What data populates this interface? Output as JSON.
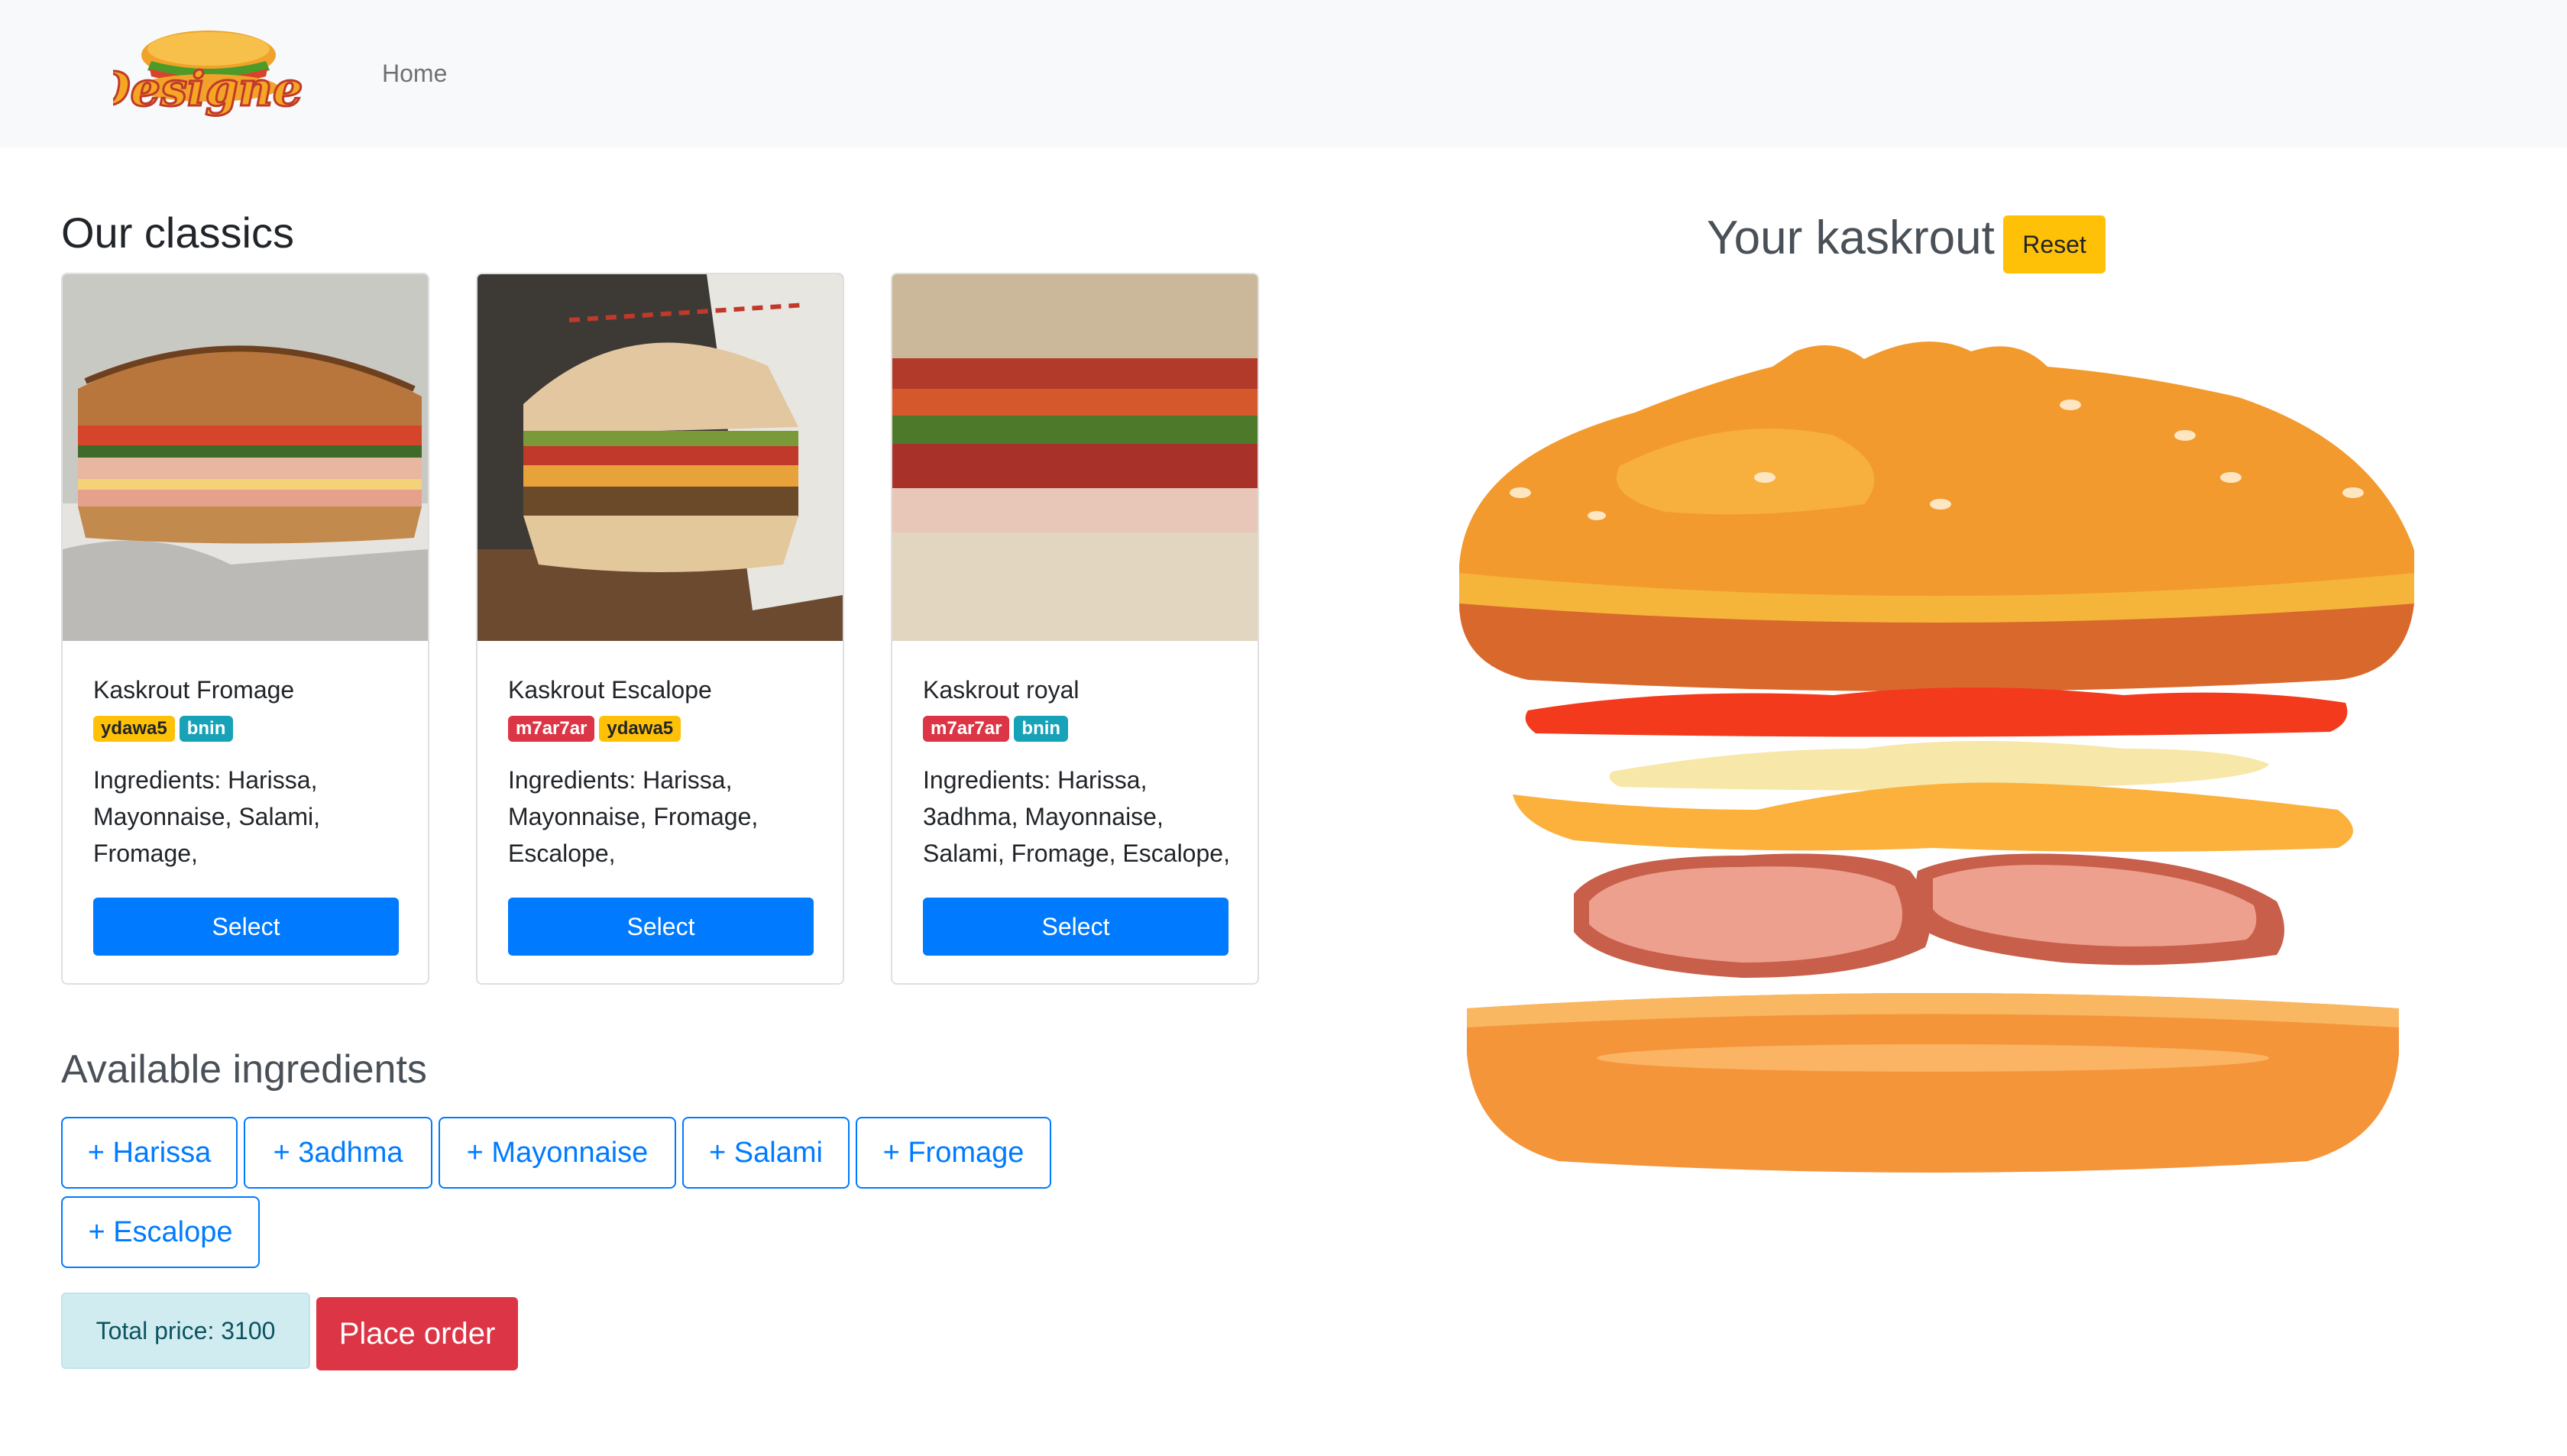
{
  "navbar": {
    "logo_text": "Designer",
    "home_link": "Home"
  },
  "classics": {
    "heading": "Our classics",
    "cards": [
      {
        "title": "Kaskrout Fromage",
        "badges": [
          {
            "label": "ydawa5",
            "color": "#ffc107"
          },
          {
            "label": "bnin",
            "color": "#17a2b8"
          }
        ],
        "ingredients": "Ingredients: Harissa, Mayonnaise, Salami, Fromage,",
        "select_label": "Select"
      },
      {
        "title": "Kaskrout Escalope",
        "badges": [
          {
            "label": "m7ar7ar",
            "color": "#dc3545"
          },
          {
            "label": "ydawa5",
            "color": "#ffc107"
          }
        ],
        "ingredients": "Ingredients: Harissa, Mayonnaise, Fromage, Escalope,",
        "select_label": "Select"
      },
      {
        "title": "Kaskrout royal",
        "badges": [
          {
            "label": "m7ar7ar",
            "color": "#dc3545"
          },
          {
            "label": "bnin",
            "color": "#17a2b8"
          }
        ],
        "ingredients": "Ingredients: Harissa, 3adhma, Mayonnaise, Salami, Fromage, Escalope,",
        "select_label": "Select"
      }
    ]
  },
  "ingredients": {
    "heading": "Available ingredients",
    "buttons": [
      "+ Harissa",
      "+ 3adhma",
      "+ Mayonnaise",
      "+ Salami",
      "+ Fromage",
      "+ Escalope"
    ]
  },
  "order": {
    "total_price": "Total price: 3100",
    "place_order_label": "Place order"
  },
  "builder": {
    "heading": "Your kaskrout",
    "reset_label": "Reset"
  },
  "colors": {
    "primary": "#007bff",
    "danger": "#dc3545",
    "warning": "#ffc107",
    "info": "#17a2b8"
  }
}
